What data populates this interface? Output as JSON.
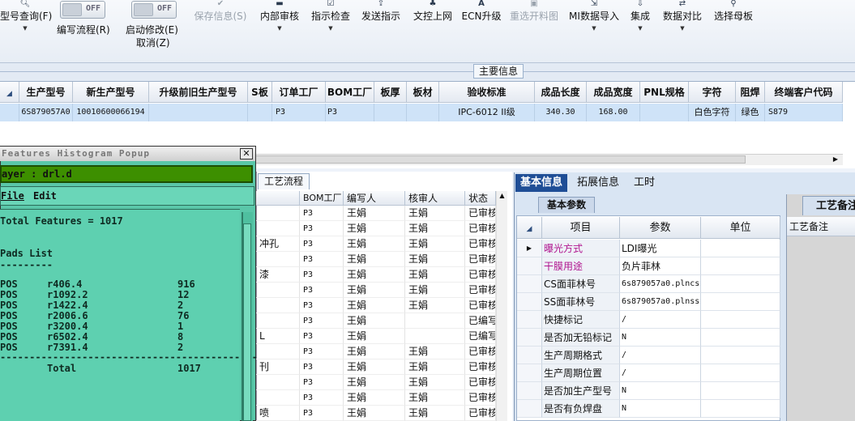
{
  "toolbar": {
    "items": [
      {
        "label": "型号查询(F)",
        "icon": "magnifier-icon",
        "dropdown": true
      },
      {
        "label": "编写流程(R)"
      },
      {
        "label": "启动修改(E)",
        "sub": "取消(Z)"
      },
      {
        "label": "保存信息(S)",
        "icon": "check-icon",
        "disabled": true
      },
      {
        "label": "内部审核",
        "icon": "printer-icon",
        "dropdown": true
      },
      {
        "label": "指示检查",
        "icon": "doc-check-icon",
        "dropdown": true
      },
      {
        "label": "发送指示",
        "icon": "upload-icon"
      },
      {
        "label": "文控上网",
        "icon": "network-icon"
      },
      {
        "label": "ECN升级",
        "icon": "letter-a-icon"
      },
      {
        "label": "重选开料图",
        "icon": "image-icon",
        "disabled": true
      },
      {
        "label": "MI数据导入",
        "icon": "import-icon",
        "dropdown": true
      },
      {
        "label": "集成",
        "icon": "download-icon",
        "dropdown": true
      },
      {
        "label": "数据对比",
        "icon": "compare-icon",
        "dropdown": true
      },
      {
        "label": "选择母板",
        "icon": "tree-icon"
      }
    ],
    "toggle_state": "OFF"
  },
  "main_info": {
    "label": "主要信息"
  },
  "top_grid": {
    "headers": [
      "生产型号",
      "新生产型号",
      "升级前旧生产型号",
      "S板",
      "订单工厂",
      "BOM工厂",
      "板厚",
      "板材",
      "验收标准",
      "成品长度",
      "成品宽度",
      "PNL规格",
      "字符",
      "阻焊",
      "终端客户代码"
    ],
    "row": [
      "6S879057A0",
      "10010600066194",
      "",
      "",
      "P3",
      "P3",
      "",
      "",
      "IPC-6012 II级",
      "340.30",
      "168.00",
      "",
      "白色字符",
      "绿色",
      "S879"
    ]
  },
  "popup": {
    "title": "Features Histogram Popup",
    "layer": "ayer :  drl.d",
    "menu": [
      "File",
      "Edit"
    ],
    "total_line": "Total Features = 1017",
    "list_title": "Pads List",
    "separator_short": "---------",
    "rows": [
      {
        "type": "POS",
        "sym": "r406.4",
        "count": "916"
      },
      {
        "type": "POS",
        "sym": "r1092.2",
        "count": "12"
      },
      {
        "type": "POS",
        "sym": "r1422.4",
        "count": "2"
      },
      {
        "type": "POS",
        "sym": "r2006.6",
        "count": "76"
      },
      {
        "type": "POS",
        "sym": "r3200.4",
        "count": "1"
      },
      {
        "type": "POS",
        "sym": "r6502.4",
        "count": "8"
      },
      {
        "type": "POS",
        "sym": "r7391.4",
        "count": "2"
      }
    ],
    "separator_long": "--------------------------------------------",
    "total_label": "Total",
    "total_value": "1017"
  },
  "process_table": {
    "tab": "工艺流程",
    "headers": [
      "BOM工厂",
      "编写人",
      "核审人",
      "状态"
    ],
    "rows": [
      {
        "name": "",
        "bom": "P3",
        "writer": "王娟",
        "reviewer": "王娟",
        "status": "已审核"
      },
      {
        "name": "",
        "bom": "P3",
        "writer": "王娟",
        "reviewer": "王娟",
        "status": "已审核"
      },
      {
        "name": "冲孔",
        "bom": "P3",
        "writer": "王娟",
        "reviewer": "王娟",
        "status": "已审核"
      },
      {
        "name": "",
        "bom": "P3",
        "writer": "王娟",
        "reviewer": "王娟",
        "status": "已审核"
      },
      {
        "name": "漆",
        "bom": "P3",
        "writer": "王娟",
        "reviewer": "王娟",
        "status": "已审核"
      },
      {
        "name": "",
        "bom": "P3",
        "writer": "王娟",
        "reviewer": "王娟",
        "status": "已审核"
      },
      {
        "name": "",
        "bom": "P3",
        "writer": "王娟",
        "reviewer": "王娟",
        "status": "已审核"
      },
      {
        "name": "",
        "bom": "P3",
        "writer": "王娟",
        "reviewer": "",
        "status": "已编写"
      },
      {
        "name": "L",
        "bom": "P3",
        "writer": "王娟",
        "reviewer": "",
        "status": "已编写"
      },
      {
        "name": "",
        "bom": "P3",
        "writer": "王娟",
        "reviewer": "王娟",
        "status": "已审核"
      },
      {
        "name": "刊",
        "bom": "P3",
        "writer": "王娟",
        "reviewer": "王娟",
        "status": "已审核"
      },
      {
        "name": "",
        "bom": "P3",
        "writer": "王娟",
        "reviewer": "王娟",
        "status": "已审核"
      },
      {
        "name": "",
        "bom": "P3",
        "writer": "王娟",
        "reviewer": "王娟",
        "status": "已审核"
      },
      {
        "name": "喷",
        "bom": "P3",
        "writer": "王娟",
        "reviewer": "王娟",
        "status": "已审核"
      }
    ]
  },
  "right_panel": {
    "tabs": [
      "基本信息",
      "拓展信息",
      "工时"
    ],
    "subtab": "基本参数",
    "headers": [
      "项目",
      "参数",
      "单位"
    ],
    "rows": [
      {
        "item": "曝光方式",
        "param": "LDI曝光",
        "unit": "",
        "highlight": true
      },
      {
        "item": "干膜用途",
        "param": "负片菲林",
        "unit": "",
        "highlight": true
      },
      {
        "item": "CS面菲林号",
        "param": "6s879057a0.plncs",
        "unit": ""
      },
      {
        "item": "SS面菲林号",
        "param": "6s879057a0.plnss",
        "unit": ""
      },
      {
        "item": "快捷标记",
        "param": "/",
        "unit": ""
      },
      {
        "item": "是否加无铅标记",
        "param": "N",
        "unit": ""
      },
      {
        "item": "生产周期格式",
        "param": "/",
        "unit": ""
      },
      {
        "item": "生产周期位置",
        "param": "/",
        "unit": ""
      },
      {
        "item": "是否加生产型号",
        "param": "N",
        "unit": ""
      },
      {
        "item": "是否有负焊盘",
        "param": "N",
        "unit": ""
      }
    ],
    "note_tab": "工艺备注",
    "note_header": "工艺备注"
  },
  "colors": {
    "highlight_text": "#b0158f",
    "selected_row": "#cfe3f8",
    "popup_bg": "#5ed0b0",
    "tab_active": "#1f4e96"
  }
}
